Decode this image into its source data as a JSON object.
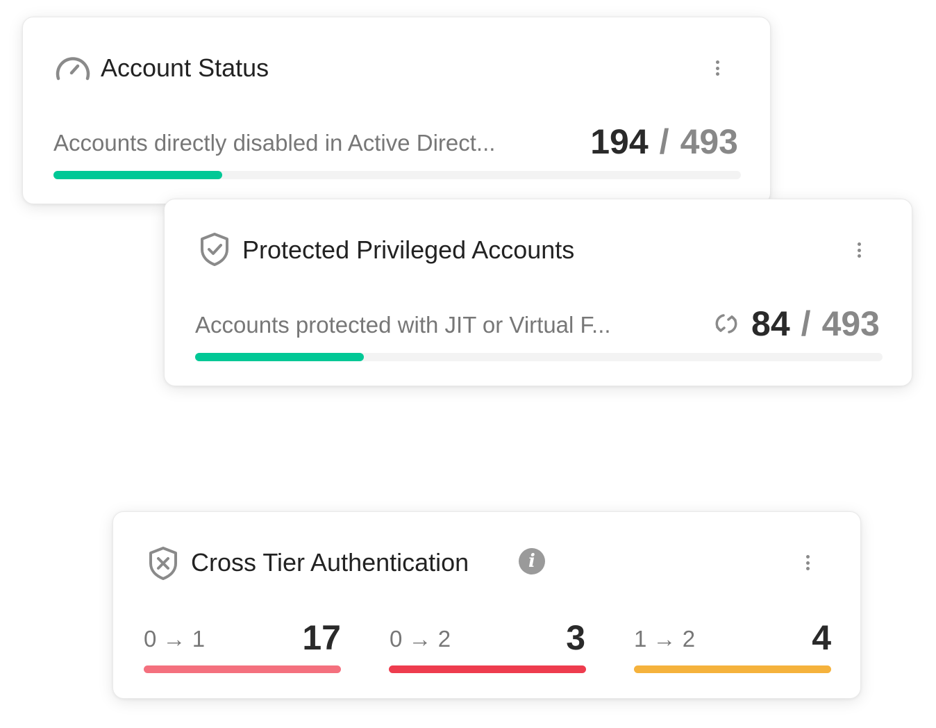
{
  "account_status": {
    "title": "Account Status",
    "icon": "speedometer-icon",
    "description": "Accounts directly disabled in Active Direct...",
    "value": "194",
    "separator": "/",
    "total": "493",
    "progress_fraction": 0.245,
    "bar_color": "#00c896"
  },
  "protected_privileged": {
    "title": "Protected Privileged Accounts",
    "icon": "shield-check-icon",
    "description": "Accounts protected with JIT or Virtual F...",
    "sync_icon": "sync-icon",
    "value": "84",
    "separator": "/",
    "total": "493",
    "progress_fraction": 0.245,
    "bar_color": "#00c896"
  },
  "cross_tier": {
    "title": "Cross Tier Authentication",
    "icon": "shield-cross-icon",
    "info_icon": "info-icon",
    "info_glyph": "i",
    "tiers": [
      {
        "from": "0",
        "arrow": "→",
        "to": "1",
        "value": "17",
        "color": "#f4707e"
      },
      {
        "from": "0",
        "arrow": "→",
        "to": "2",
        "value": "3",
        "color": "#ee3c4e"
      },
      {
        "from": "1",
        "arrow": "→",
        "to": "2",
        "value": "4",
        "color": "#f5b23c"
      }
    ]
  },
  "colors": {
    "track": "#f3f3f3",
    "text_primary": "#222222",
    "text_secondary": "#777777"
  }
}
